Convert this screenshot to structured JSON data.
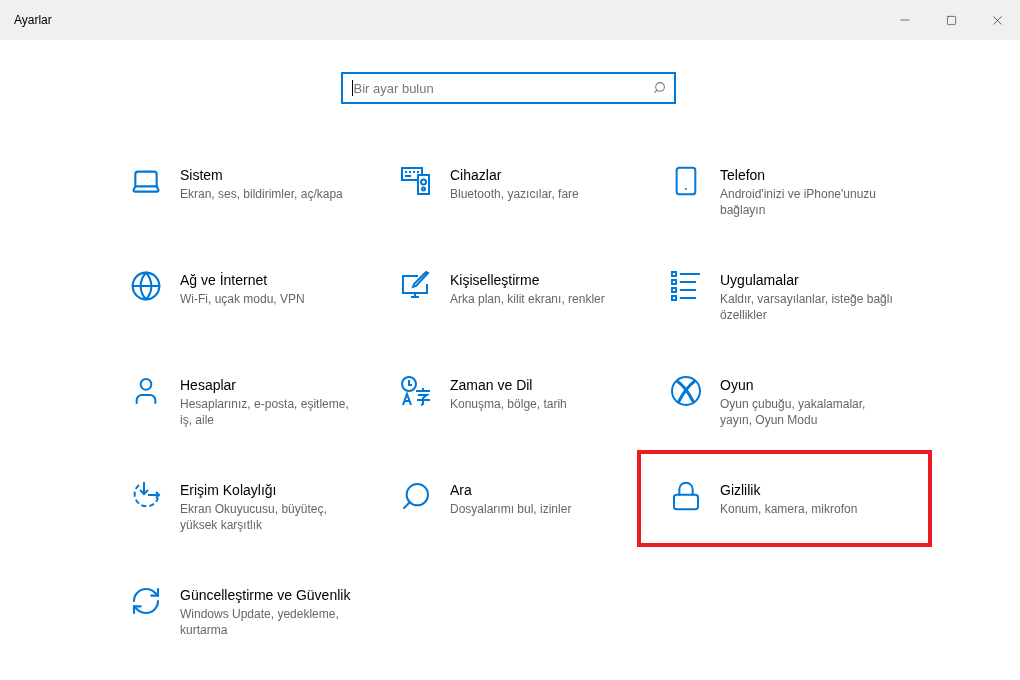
{
  "window": {
    "title": "Ayarlar"
  },
  "search": {
    "placeholder": "Bir ayar bulun",
    "focused": true
  },
  "categories": [
    {
      "kind": "system",
      "title": "Sistem",
      "description": "Ekran, ses, bildirimler, aç/kapa",
      "highlighted": false
    },
    {
      "kind": "devices",
      "title": "Cihazlar",
      "description": "Bluetooth, yazıcılar, fare",
      "highlighted": false
    },
    {
      "kind": "phone",
      "title": "Telefon",
      "description": "Android'inizi ve iPhone'unuzu bağlayın",
      "highlighted": false
    },
    {
      "kind": "network",
      "title": "Ağ ve İnternet",
      "description": "Wi-Fi, uçak modu, VPN",
      "highlighted": false
    },
    {
      "kind": "personalization",
      "title": "Kişiselleştirme",
      "description": "Arka plan, kilit ekranı, renkler",
      "highlighted": false
    },
    {
      "kind": "apps",
      "title": "Uygulamalar",
      "description": "Kaldır, varsayılanlar, isteğe bağlı özellikler",
      "highlighted": false
    },
    {
      "kind": "accounts",
      "title": "Hesaplar",
      "description": "Hesaplarınız, e-posta, eşitleme, iş, aile",
      "highlighted": false
    },
    {
      "kind": "time",
      "title": "Zaman ve Dil",
      "description": "Konuşma, bölge, tarih",
      "highlighted": false
    },
    {
      "kind": "gaming",
      "title": "Oyun",
      "description": "Oyun çubuğu, yakalamalar, yayın, Oyun Modu",
      "highlighted": false
    },
    {
      "kind": "accessibility",
      "title": "Erişim Kolaylığı",
      "description": "Ekran Okuyucusu, büyüteç, yüksek karşıtlık",
      "highlighted": false
    },
    {
      "kind": "search",
      "title": "Ara",
      "description": "Dosyalarımı bul, izinler",
      "highlighted": false
    },
    {
      "kind": "privacy",
      "title": "Gizlilik",
      "description": "Konum, kamera, mikrofon",
      "highlighted": true
    },
    {
      "kind": "update",
      "title": "Güncelleştirme ve Güvenlik",
      "description": "Windows Update, yedekleme, kurtarma",
      "highlighted": false
    }
  ]
}
